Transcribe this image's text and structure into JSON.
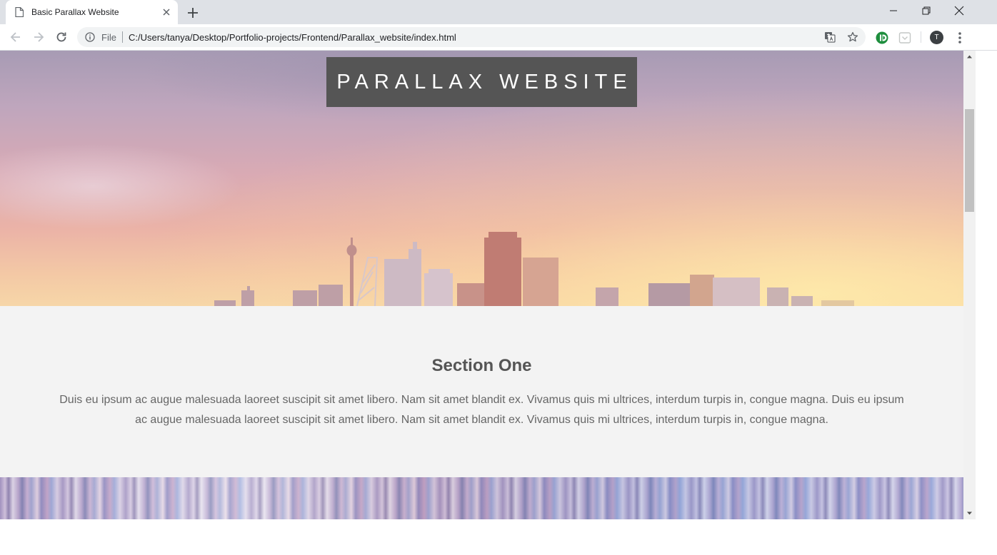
{
  "browser": {
    "tab_title": "Basic Parallax Website",
    "address_scheme_label": "File",
    "url": "C:/Users/tanya/Desktop/Portfolio-projects/Frontend/Parallax_website/index.html",
    "profile_initial": "T"
  },
  "page": {
    "hero_title": "PARALLAX WEBSITE",
    "section_one": {
      "heading": "Section One",
      "body": "Duis eu ipsum ac augue malesuada laoreet suscipit sit amet libero. Nam sit amet blandit ex. Vivamus quis mi ultrices, interdum turpis in, congue magna. Duis eu ipsum ac augue malesuada laoreet suscipit sit amet libero. Nam sit amet blandit ex. Vivamus quis mi ultrices, interdum turpis in, congue magna."
    }
  },
  "colors": {
    "title_box": "#555555",
    "section_background": "#f3f3f3",
    "heading_text": "#555555",
    "body_text": "#666666",
    "extension_green": "#1e8e3e"
  },
  "icons": {
    "tab_favicon": "page-icon",
    "tab_close": "close-icon",
    "new_tab": "plus-icon",
    "back": "arrow-left-icon",
    "forward": "arrow-right-icon",
    "reload": "reload-icon",
    "site_info": "info-icon",
    "translate": "translate-icon",
    "bookmark": "star-icon",
    "extension_1": "grammarly-icon",
    "extension_2": "pocket-icon",
    "menu": "kebab-menu-icon"
  }
}
